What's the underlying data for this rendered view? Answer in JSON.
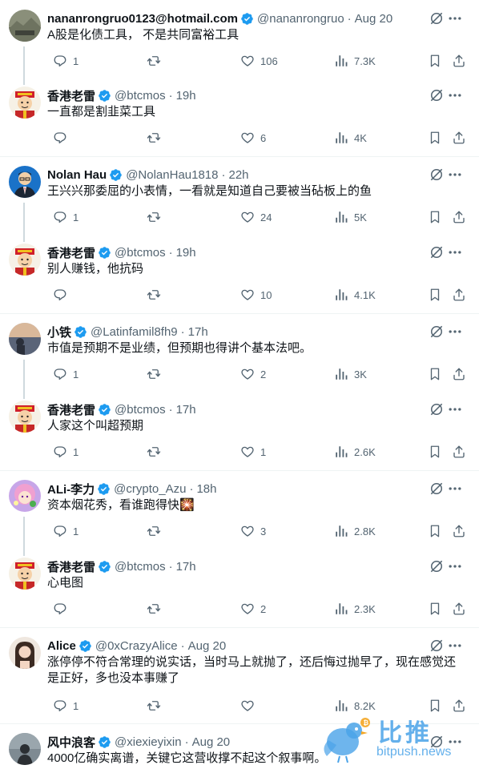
{
  "colors": {
    "accent": "#1d9bf0",
    "text": "#0f1419",
    "secondary": "#536471",
    "divider": "#eff3f4",
    "thread": "#cfd9de"
  },
  "tweets": [
    {
      "name": "nananrongruo0123@hotmail.com",
      "handle": "@nananrongruo",
      "time": "Aug 20",
      "text": "A股是化债工具，  不是共同富裕工具",
      "reply_count": "1",
      "retweet_count": "",
      "like_count": "106",
      "views": "7.3K",
      "avatar_icon": "landscape-avatar"
    },
    {
      "name": "香港老雷",
      "handle": "@btcmos",
      "time": "19h",
      "text": "一直都是割韭菜工具",
      "reply_count": "",
      "retweet_count": "",
      "like_count": "6",
      "views": "4K",
      "avatar_icon": "cartoon-avatar"
    },
    {
      "name": "Nolan Hau",
      "handle": "@NolanHau1818",
      "time": "22h",
      "text": "王兴兴那委屈的小表情，一看就是知道自己要被当砧板上的鱼",
      "reply_count": "1",
      "retweet_count": "",
      "like_count": "24",
      "views": "5K",
      "avatar_icon": "suit-avatar"
    },
    {
      "name": "香港老雷",
      "handle": "@btcmos",
      "time": "19h",
      "text": "别人赚钱，他抗码",
      "reply_count": "",
      "retweet_count": "",
      "like_count": "10",
      "views": "4.1K",
      "avatar_icon": "cartoon-avatar"
    },
    {
      "name": "小铁",
      "handle": "@Latinfamil8fh9",
      "time": "17h",
      "text": "市值是预期不是业绩，但预期也得讲个基本法吧。",
      "reply_count": "1",
      "retweet_count": "",
      "like_count": "2",
      "views": "3K",
      "avatar_icon": "sunset-avatar"
    },
    {
      "name": "香港老雷",
      "handle": "@btcmos",
      "time": "17h",
      "text": "人家这个叫超预期",
      "reply_count": "1",
      "retweet_count": "",
      "like_count": "1",
      "views": "2.6K",
      "avatar_icon": "cartoon-avatar"
    },
    {
      "name": "ALi-李力",
      "handle": "@crypto_Azu",
      "time": "18h",
      "text": "资本烟花秀，看谁跑得快🎇",
      "reply_count": "1",
      "retweet_count": "",
      "like_count": "3",
      "views": "2.8K",
      "avatar_icon": "anime-avatar"
    },
    {
      "name": "香港老雷",
      "handle": "@btcmos",
      "time": "17h",
      "text": "心电图",
      "reply_count": "",
      "retweet_count": "",
      "like_count": "2",
      "views": "2.3K",
      "avatar_icon": "cartoon-avatar"
    },
    {
      "name": "Alice",
      "handle": "@0xCrazyAlice",
      "time": "Aug 20",
      "text": "涨停停不符合常理的说实话，当时马上就抛了，还后悔过抛早了，现在感觉还是正好，多也没本事赚了",
      "reply_count": "1",
      "retweet_count": "",
      "like_count": "",
      "views": "8.2K",
      "avatar_icon": "woman-avatar"
    },
    {
      "name": "风中浪客",
      "handle": "@xiexieyixin",
      "time": "Aug 20",
      "text": "4000亿确实离谱，关键它这营收撑不起这个叙事啊。",
      "reply_count": "",
      "retweet_count": "",
      "like_count": "",
      "views": "",
      "avatar_icon": "silhouette-avatar"
    }
  ],
  "watermark": {
    "cn": "比推",
    "en": "bitpush.news",
    "icon": "bird-logo-icon"
  }
}
